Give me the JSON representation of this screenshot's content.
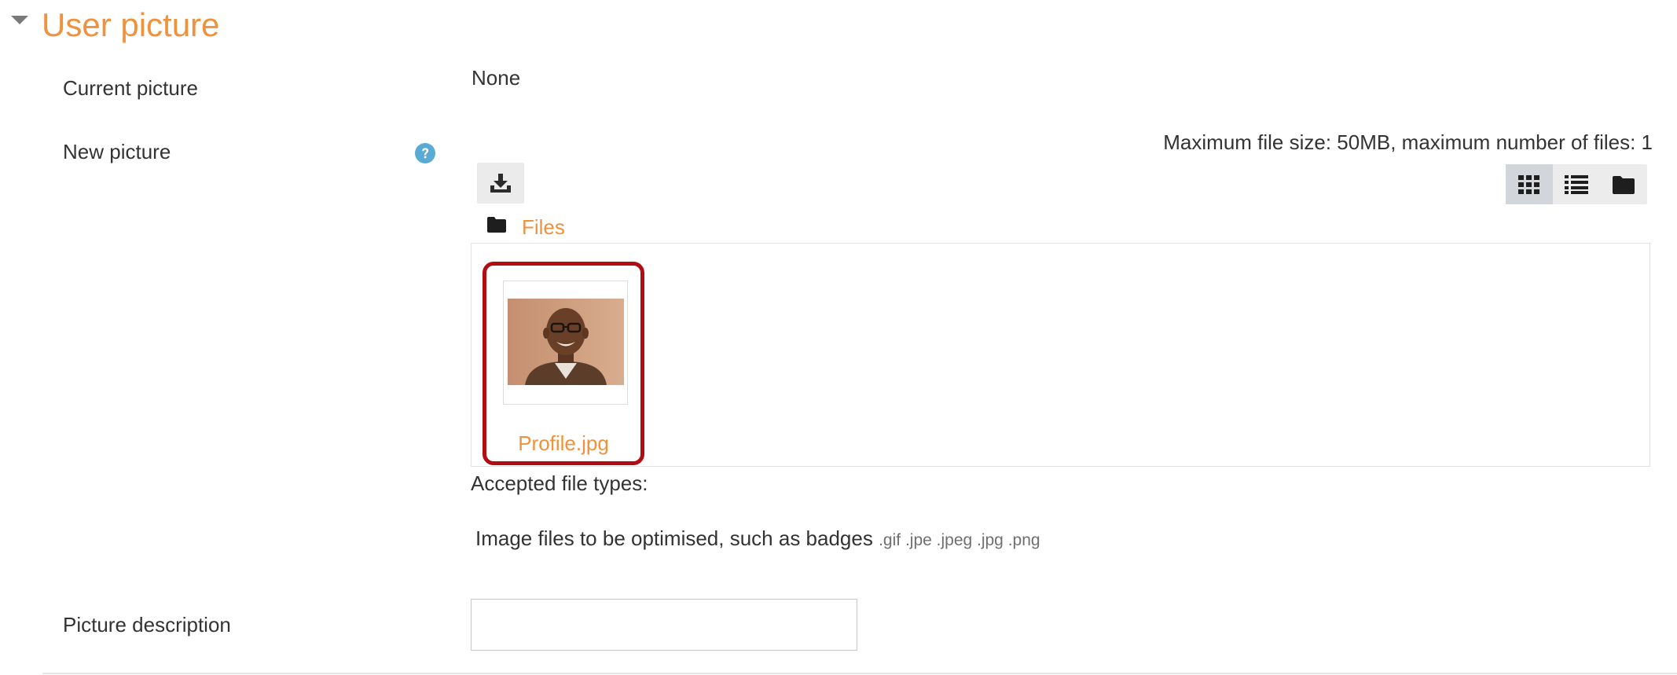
{
  "section": {
    "title": "User picture"
  },
  "fields": {
    "current_picture_label": "Current picture",
    "current_picture_value": "None",
    "new_picture_label": "New picture",
    "picture_description_label": "Picture description",
    "picture_description_value": ""
  },
  "filepicker": {
    "max_info": "Maximum file size: 50MB, maximum number of files: 1",
    "path_label": "Files",
    "files": [
      {
        "name": "Profile.jpg"
      }
    ],
    "view_modes": [
      "grid-icon",
      "list-icon",
      "folder-icon"
    ],
    "active_view": "grid-icon"
  },
  "accepted": {
    "label": "Accepted file types:",
    "description": "Image files to be optimised, such as badges",
    "extensions": ".gif .jpe .jpeg .jpg .png"
  },
  "colors": {
    "accent": "#f0923d",
    "highlight_border": "#b00e12",
    "help_icon": "#5aaad6"
  }
}
